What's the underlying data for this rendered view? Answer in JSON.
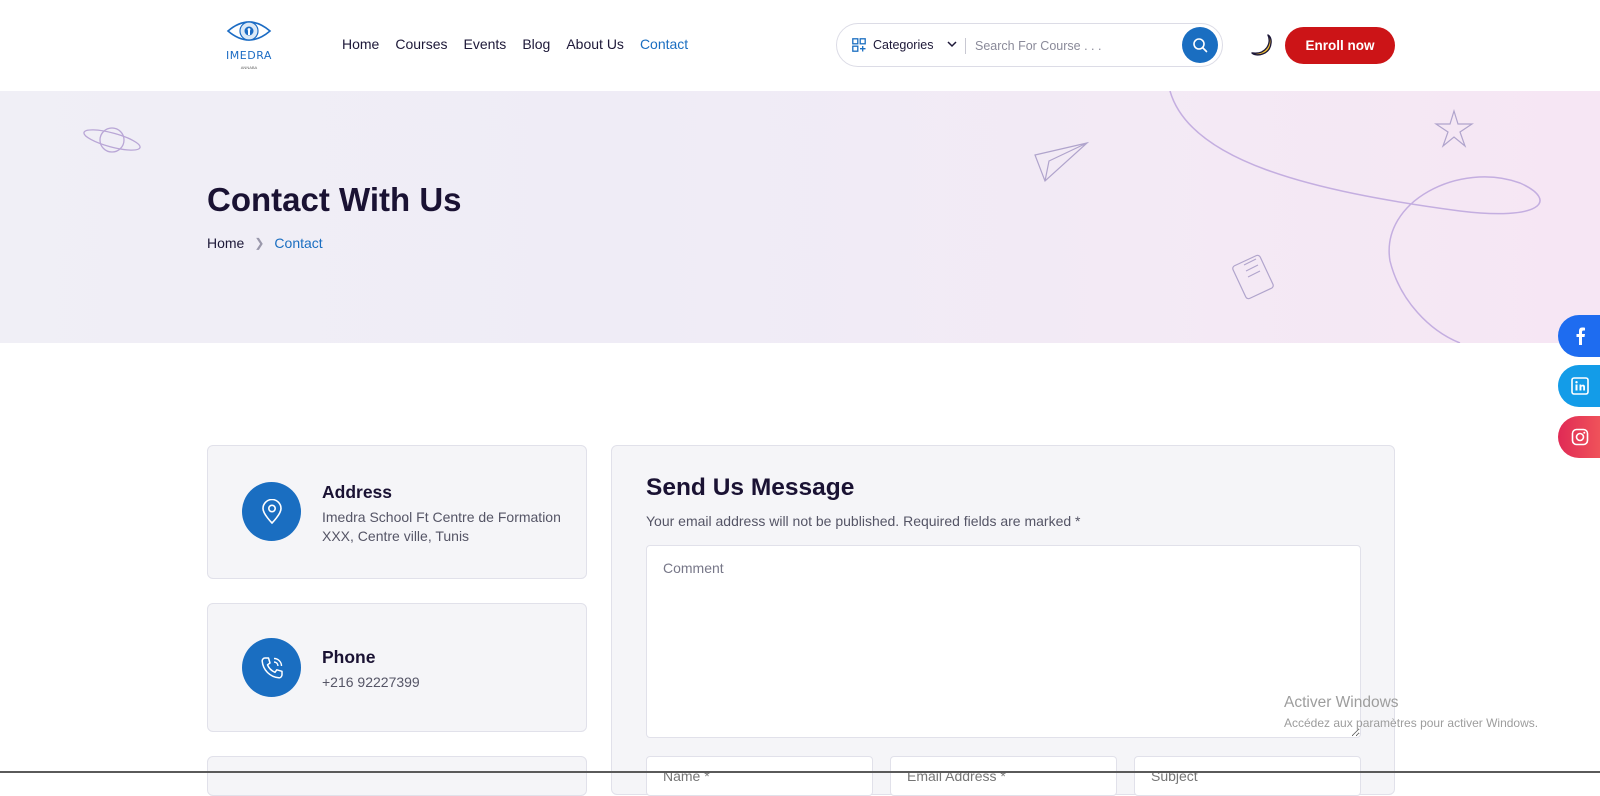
{
  "logo": {
    "brand": "IMEDRA",
    "tagline": "ANNABA"
  },
  "nav": [
    {
      "label": "Home",
      "active": false
    },
    {
      "label": "Courses",
      "active": false
    },
    {
      "label": "Events",
      "active": false
    },
    {
      "label": "Blog",
      "active": false
    },
    {
      "label": "About Us",
      "active": false
    },
    {
      "label": "Contact",
      "active": true
    }
  ],
  "search": {
    "category_label": "Categories",
    "placeholder": "Search For Course . . ."
  },
  "header": {
    "enroll_label": "Enroll now"
  },
  "hero": {
    "title": "Contact With Us",
    "breadcrumb_home": "Home",
    "breadcrumb_current": "Contact"
  },
  "social": [
    "facebook-icon",
    "linkedin-icon",
    "instagram-icon"
  ],
  "address": {
    "title": "Address",
    "text": "Imedra School Ft Centre de Formation XXX, Centre ville, Tunis"
  },
  "phone": {
    "title": "Phone",
    "text": "+216 92227399"
  },
  "form": {
    "title": "Send Us Message",
    "note": "Your email address will not be published. Required fields are marked *",
    "comment_placeholder": "Comment",
    "name_placeholder": "Name *",
    "email_placeholder": "Email Address *",
    "subject_placeholder": "Subject"
  },
  "watermark": {
    "line1": "Activer Windows",
    "line2": "Accédez aux paramètres pour activer Windows."
  },
  "colors": {
    "primary": "#1a6ec1",
    "enroll": "#cc1417",
    "heading": "#1a1233"
  }
}
